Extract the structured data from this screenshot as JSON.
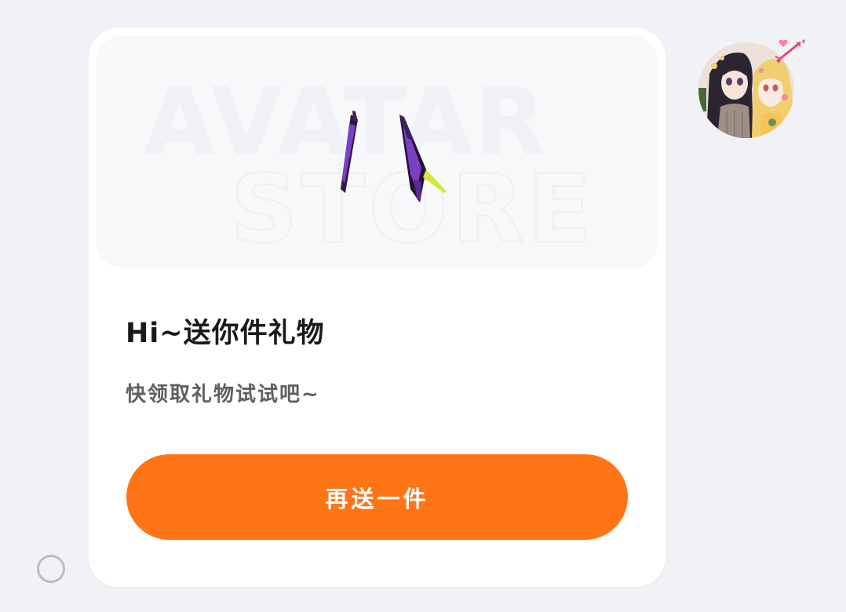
{
  "banner": {
    "watermark_line1": "AVATAR",
    "watermark_line2": "STORE",
    "item_icon": "purple-claw-blades-icon"
  },
  "card": {
    "title": "Hi~送你件礼物",
    "subtitle": "快领取礼物试试吧~",
    "cta_label": "再送一件"
  },
  "colors": {
    "accent": "#ff7415",
    "background": "#f1f2f6",
    "card": "#ffffff",
    "title": "#1a1a1a",
    "subtitle": "#5f5f5f"
  },
  "icons": {
    "avatar": "anime-couple-avatar",
    "avatar_badge": "cupid-arrow-icon",
    "loader": "ring-icon"
  }
}
